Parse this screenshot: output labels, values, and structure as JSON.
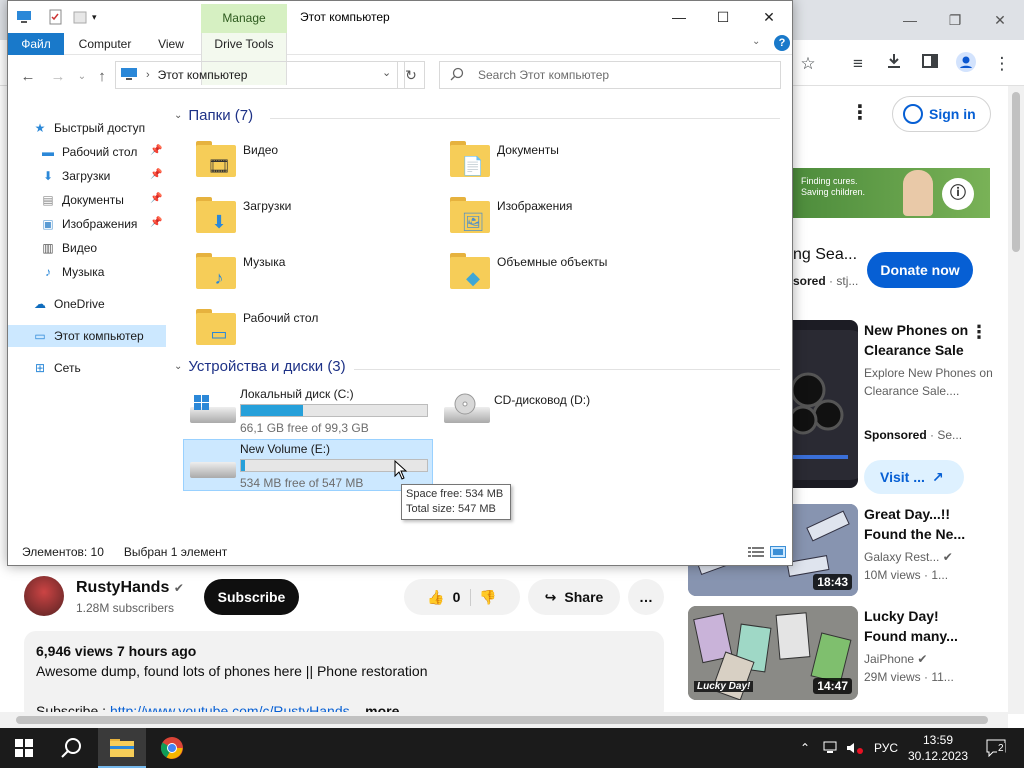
{
  "browser": {
    "sign_in": "Sign in",
    "ad": {
      "banner_text": "Finding cures.\nSaving children.",
      "title": "ng Sea...",
      "sponsored": "sored",
      "sponsor_suffix": "· stj...",
      "donate": "Donate now"
    },
    "recommendations": [
      {
        "title": "New Phones on Clearance Sale",
        "sub1": "Explore New Phones on Clearance Sale....",
        "sponsored": "Sponsored",
        "sponsor_suffix": "· Se...",
        "visit": "Visit ..."
      },
      {
        "title": "Great Day...!! Found the Ne...",
        "channel": "Galaxy Rest...",
        "meta": "10M views · 1...",
        "duration": "18:43"
      },
      {
        "title": "Lucky Day! Found many...",
        "channel": "JaiPhone",
        "meta": "29M views · 11...",
        "duration": "14:47",
        "thumb_caption": "Lucky Day!"
      }
    ],
    "channel": {
      "name": "RustyHands",
      "subscribers": "1.28M subscribers",
      "subscribe": "Subscribe"
    },
    "actions": {
      "likes": "0",
      "share": "Share"
    },
    "description": {
      "stats": "6,946 views  7 hours ago",
      "text": "Awesome dump, found lots of phones here || Phone restoration",
      "link_prefix": "Subscribe : ",
      "link": "http://www.youtube.com/c/RustyHands",
      "more": "...more"
    }
  },
  "explorer": {
    "title": "Этот компьютер",
    "manage_tab": "Manage",
    "ribbon_tabs": [
      "Файл",
      "Computer",
      "View",
      "Drive Tools"
    ],
    "address": "Этот компьютер",
    "search_placeholder": "Search Этот компьютер",
    "sidebar": [
      {
        "label": "Быстрый доступ",
        "icon": "star-icon",
        "color": "#2b88d8"
      },
      {
        "label": "Рабочий стол",
        "icon": "desktop-icon",
        "color": "#2b88d8",
        "pinned": true
      },
      {
        "label": "Загрузки",
        "icon": "download-icon",
        "color": "#2b88d8",
        "pinned": true
      },
      {
        "label": "Документы",
        "icon": "document-icon",
        "color": "#8a8a8a",
        "pinned": true
      },
      {
        "label": "Изображения",
        "icon": "pictures-icon",
        "color": "#5a9bd4",
        "pinned": true
      },
      {
        "label": "Видео",
        "icon": "video-icon",
        "color": "#555555"
      },
      {
        "label": "Музыка",
        "icon": "music-icon",
        "color": "#2b88d8"
      },
      {
        "label": "OneDrive",
        "icon": "cloud-icon",
        "color": "#0f6cbd"
      },
      {
        "label": "Этот компьютер",
        "icon": "computer-icon",
        "color": "#2b88d8"
      },
      {
        "label": "Сеть",
        "icon": "network-icon",
        "color": "#2b88d8"
      }
    ],
    "folders_header": "Папки (7)",
    "folders": [
      {
        "name": "Видео",
        "glyph": "🎞"
      },
      {
        "name": "Документы",
        "glyph": "📄"
      },
      {
        "name": "Загрузки",
        "glyph": "⬇"
      },
      {
        "name": "Изображения",
        "glyph": "🖼"
      },
      {
        "name": "Музыка",
        "glyph": "♪"
      },
      {
        "name": "Объемные объекты",
        "glyph": "◆"
      },
      {
        "name": "Рабочий стол",
        "glyph": "▭"
      }
    ],
    "drives_header": "Устройства и диски (3)",
    "drives": [
      {
        "name": "Локальный диск (C:)",
        "free": "66,1 GB free of 99,3 GB",
        "used_fraction": 0.334
      },
      {
        "name": "CD-дисковод (D:)"
      },
      {
        "name": "New Volume (E:)",
        "free": "534 MB free of 547 MB",
        "used_fraction": 0.024
      }
    ],
    "tooltip": {
      "line1": "Space free: 534 MB",
      "line2": "Total size: 547 MB"
    },
    "status": {
      "items": "Элементов: 10",
      "selected": "Выбран 1 элемент"
    }
  },
  "taskbar": {
    "language": "РУС",
    "time": "13:59",
    "date": "30.12.2023",
    "notifications": "2"
  }
}
